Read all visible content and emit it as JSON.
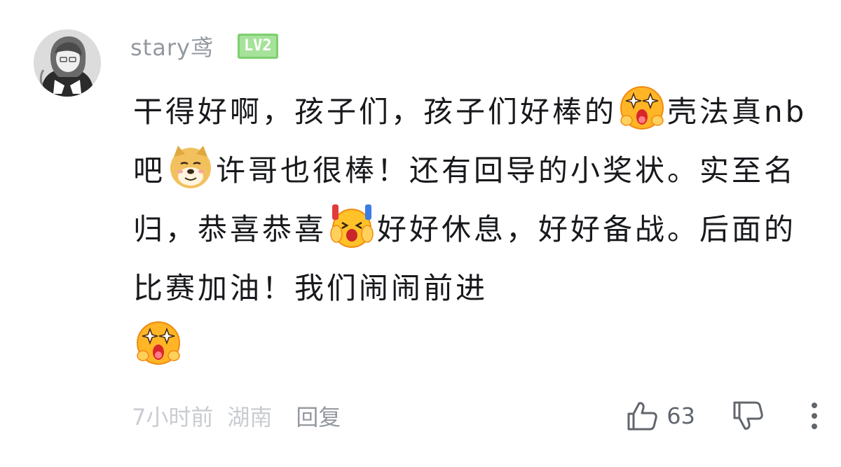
{
  "comment": {
    "user": {
      "name": "stary鸢",
      "level": "LV2",
      "level_color": "#a6e29a"
    },
    "content": {
      "segment_1": "干得好啊，孩子们，孩子们好棒的",
      "emoji_1": "starry-eyed-emoji",
      "segment_2": "壳法真nb吧",
      "emoji_2": "doge-emoji",
      "segment_3": "许哥也很棒！还有回导的小奖状。实至名归，恭喜恭喜",
      "emoji_3": "cheering-emoji",
      "segment_4": "好好休息，好好备战。后面的比赛加油！我们闹闹前进",
      "emoji_4": "starry-eyed-emoji"
    },
    "meta": {
      "time": "7小时前",
      "location": "湖南",
      "reply_label": "回复"
    },
    "actions": {
      "like_icon": "thumbs-up-icon",
      "like_count": "63",
      "dislike_icon": "thumbs-down-icon",
      "more_icon": "more-vertical-icon"
    },
    "colors": {
      "muted_text": "#9499a0",
      "light_text": "#c9ccd0",
      "body_text": "#18191c"
    }
  }
}
